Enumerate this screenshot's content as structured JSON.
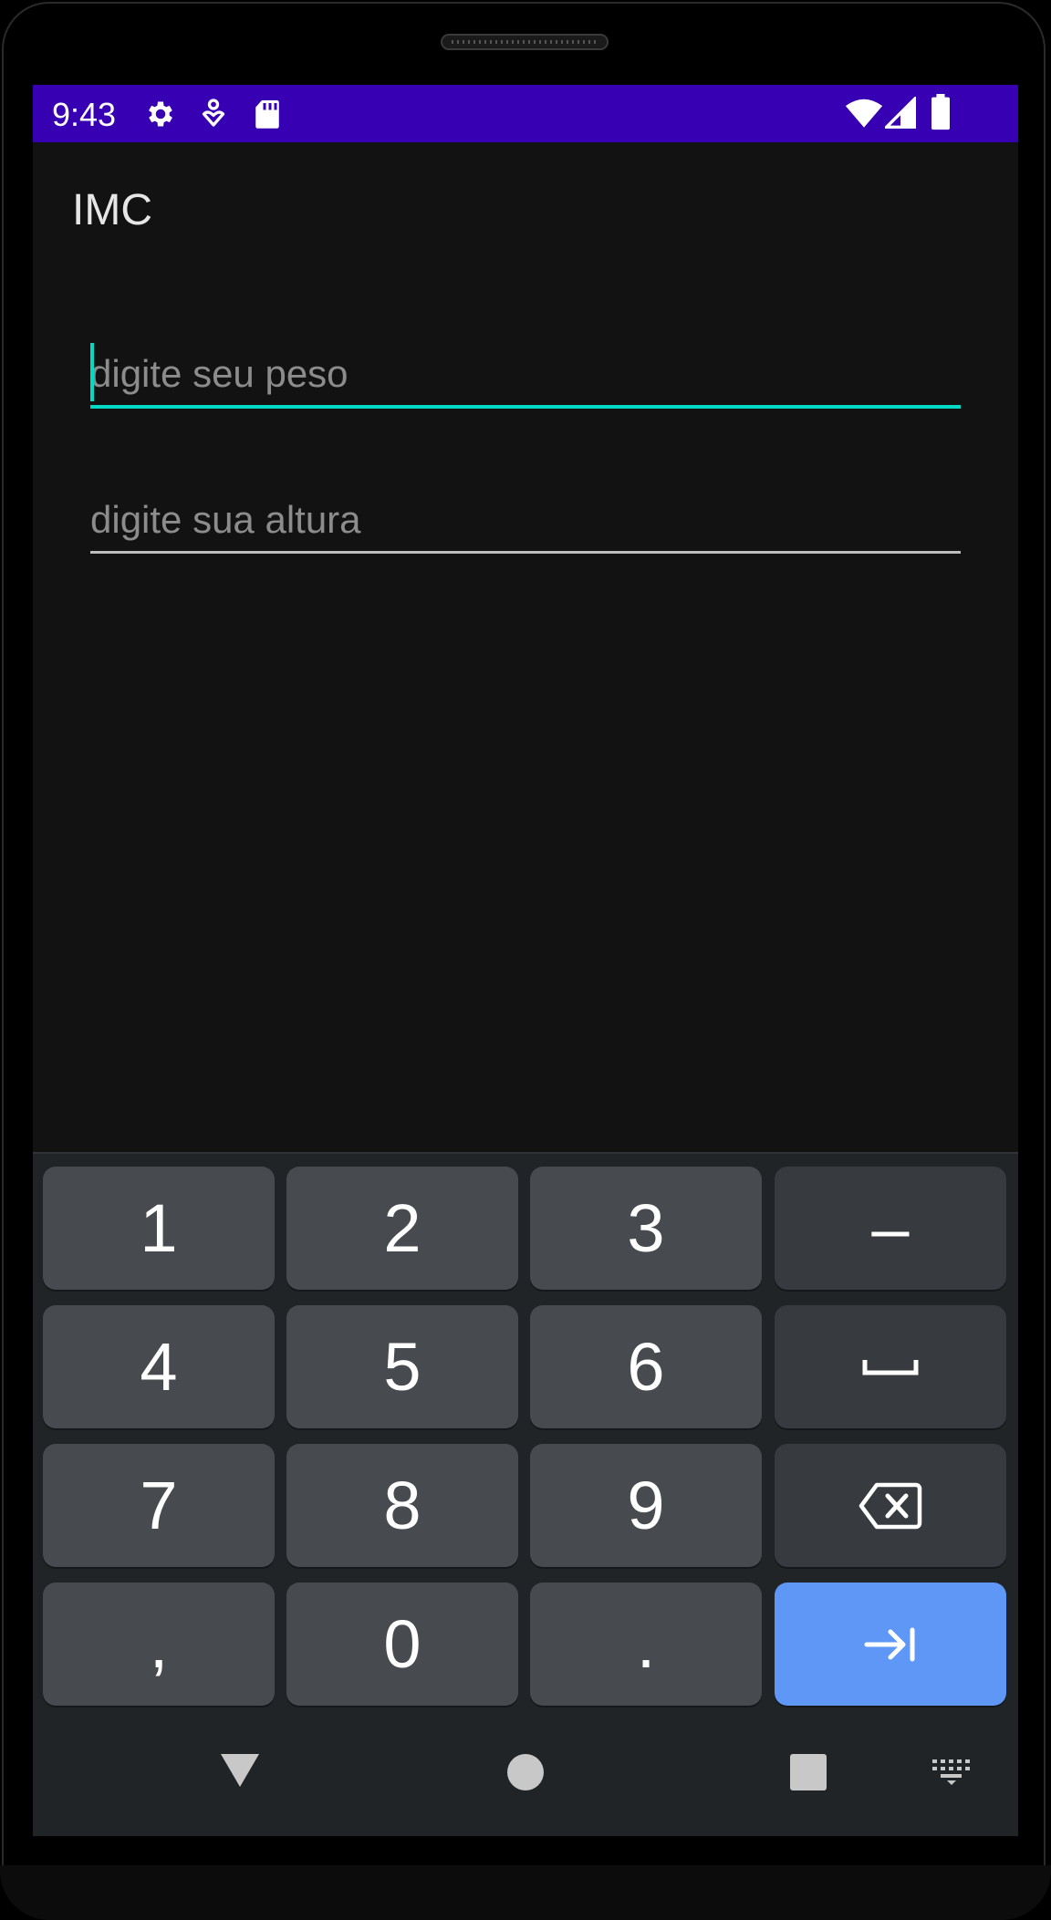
{
  "status_bar": {
    "time": "9:43",
    "left_icons": [
      "settings-icon",
      "location-pin-icon",
      "sd-card-icon"
    ],
    "right_icons": [
      "wifi-icon",
      "cell-signal-icon",
      "battery-icon"
    ],
    "background_color": "#3700b3"
  },
  "app_bar": {
    "title": "IMC"
  },
  "form": {
    "weight_placeholder": "digite seu peso",
    "weight_value": "",
    "height_placeholder": "digite sua altura",
    "height_value": "",
    "accent_color": "#03dac5"
  },
  "keyboard": {
    "keys": [
      [
        "1",
        "2",
        "3",
        "-"
      ],
      [
        "4",
        "5",
        "6",
        "space-icon"
      ],
      [
        "7",
        "8",
        "9",
        "backspace-icon"
      ],
      [
        ",",
        "0",
        ".",
        "next-tab-icon"
      ]
    ],
    "k1": "1",
    "k2": "2",
    "k3": "3",
    "kminus": "–",
    "k4": "4",
    "k5": "5",
    "k6": "6",
    "k7": "7",
    "k8": "8",
    "k9": "9",
    "kcomma": ",",
    "k0": "0",
    "kdot": ".",
    "enter_color": "#5f97f6"
  },
  "nav_bar": {
    "icons": [
      "back-icon",
      "home-icon",
      "recents-icon",
      "keyboard-switch-icon"
    ]
  }
}
